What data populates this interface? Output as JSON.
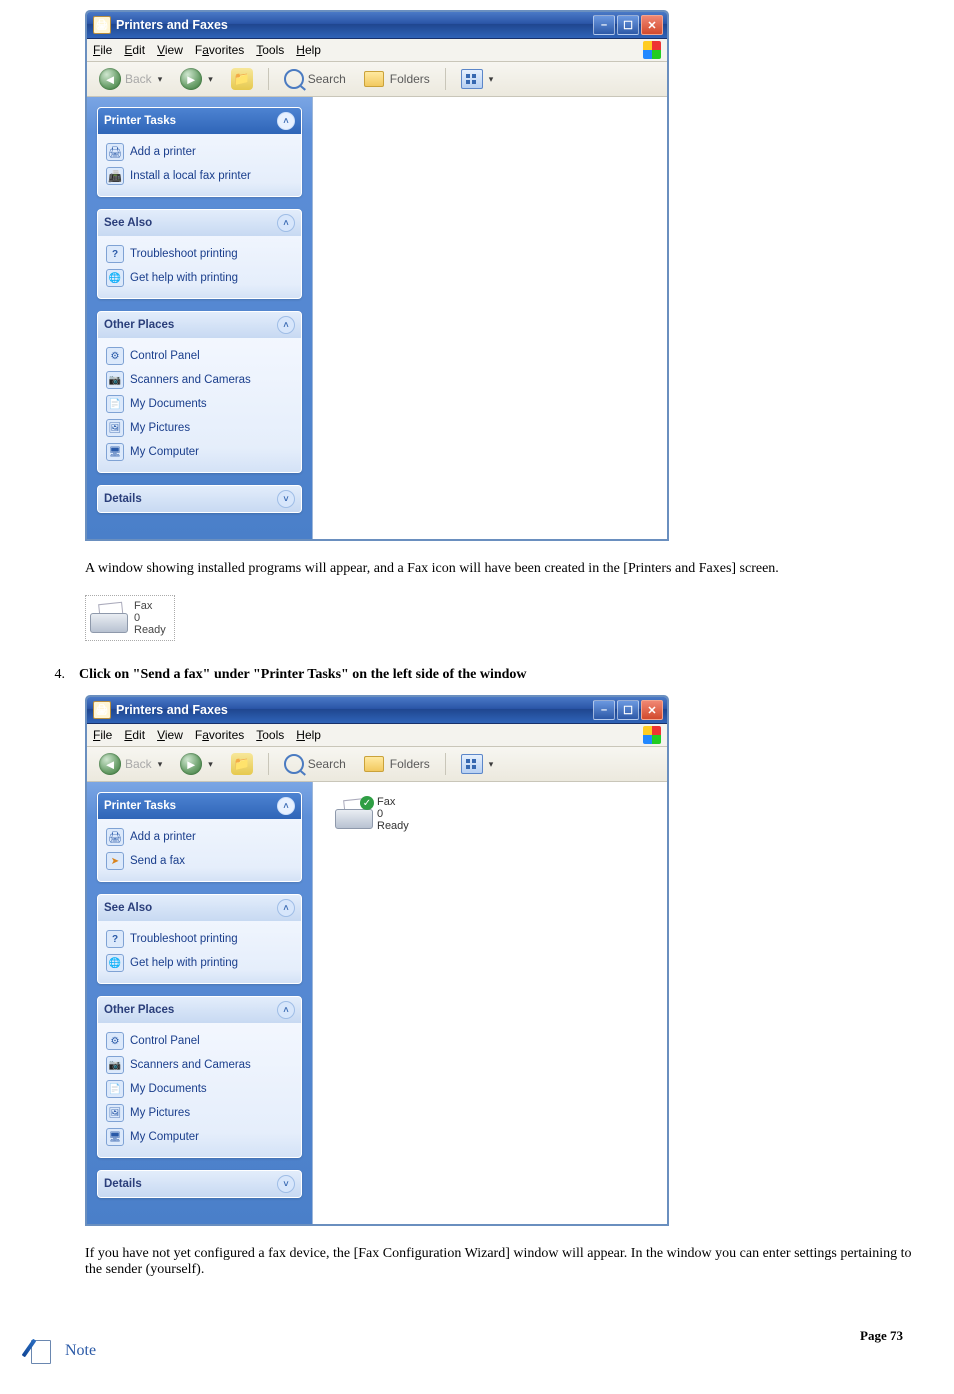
{
  "window_title": "Printers and Faxes",
  "menubar": {
    "file": "File",
    "edit": "Edit",
    "view": "View",
    "favorites": "Favorites",
    "tools": "Tools",
    "help": "Help"
  },
  "toolbar": {
    "back": "Back",
    "search": "Search",
    "folders": "Folders"
  },
  "first_window": {
    "printer_tasks": {
      "header": "Printer Tasks",
      "items": [
        "Add a printer",
        "Install a local fax printer"
      ]
    },
    "see_also": {
      "header": "See Also",
      "items": [
        "Troubleshoot printing",
        "Get help with printing"
      ]
    },
    "other_places": {
      "header": "Other Places",
      "items": [
        "Control Panel",
        "Scanners and Cameras",
        "My Documents",
        "My Pictures",
        "My Computer"
      ]
    },
    "details": {
      "header": "Details"
    }
  },
  "install_text": "A window showing installed programs will appear, and a Fax icon will have been created in the [Printers and Faxes] screen.",
  "fax_icon": {
    "name": "Fax",
    "docs": "0",
    "status": "Ready"
  },
  "step4": {
    "num": "4.",
    "text": "Click on \"Send a fax\" under \"Printer Tasks\" on the left side of the window"
  },
  "second_window": {
    "printer_tasks": {
      "header": "Printer Tasks",
      "items": [
        "Add a printer",
        "Send a fax"
      ]
    },
    "see_also": {
      "header": "See Also",
      "items": [
        "Troubleshoot printing",
        "Get help with printing"
      ]
    },
    "other_places": {
      "header": "Other Places",
      "items": [
        "Control Panel",
        "Scanners and Cameras",
        "My Documents",
        "My Pictures",
        "My Computer"
      ]
    },
    "details": {
      "header": "Details"
    },
    "fax_item": {
      "name": "Fax",
      "docs": "0",
      "status": "Ready"
    }
  },
  "config_text": "If you have not yet configured a fax device, the [Fax Configuration Wizard] window will appear. In the window you can enter settings pertaining to the sender (yourself).",
  "note_label": "Note",
  "page_label": "Page 73"
}
